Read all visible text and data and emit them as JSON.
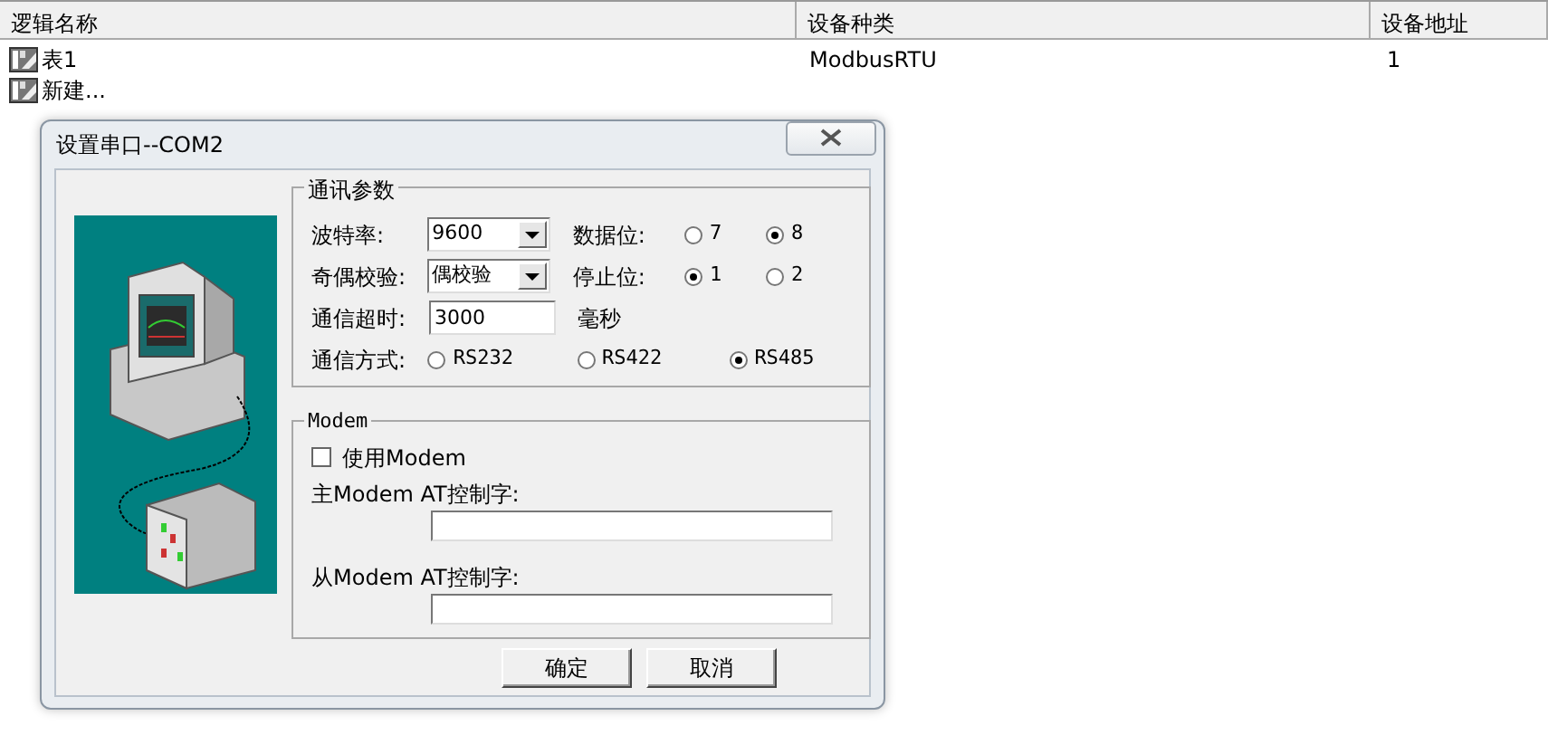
{
  "table": {
    "columns": [
      "逻辑名称",
      "设备种类",
      "设备地址"
    ],
    "rows": [
      {
        "name": "表1",
        "type": "ModbusRTU",
        "address": "1"
      },
      {
        "name": "新建..."
      }
    ]
  },
  "dialog": {
    "title": "设置串口--COM2",
    "comm_group": {
      "title": "通讯参数",
      "baud": {
        "label": "波特率:",
        "value": "9600"
      },
      "parity": {
        "label": "奇偶校验:",
        "value": "偶校验"
      },
      "timeout": {
        "label": "通信超时:",
        "value": "3000",
        "unit": "毫秒"
      },
      "data_bits": {
        "label": "数据位:",
        "options": [
          {
            "label": "7",
            "selected": false
          },
          {
            "label": "8",
            "selected": true
          }
        ]
      },
      "stop_bits": {
        "label": "停止位:",
        "options": [
          {
            "label": "1",
            "selected": true
          },
          {
            "label": "2",
            "selected": false
          }
        ]
      },
      "mode": {
        "label": "通信方式:",
        "options": [
          {
            "label": "RS232",
            "selected": false
          },
          {
            "label": "RS422",
            "selected": false
          },
          {
            "label": "RS485",
            "selected": true
          }
        ]
      }
    },
    "modem_group": {
      "title": "Modem",
      "use_modem": {
        "label": "使用Modem",
        "checked": false
      },
      "master_label": "主Modem AT控制字:",
      "slave_label": "从Modem AT控制字:"
    },
    "buttons": [
      "确定",
      "取消"
    ]
  }
}
